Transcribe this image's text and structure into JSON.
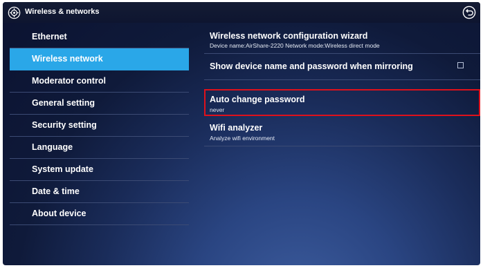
{
  "window": {
    "title": "Wireless & networks"
  },
  "sidebar": {
    "items": [
      {
        "label": "Ethernet"
      },
      {
        "label": "Wireless network"
      },
      {
        "label": "Moderator control"
      },
      {
        "label": "General setting"
      },
      {
        "label": "Security setting"
      },
      {
        "label": "Language"
      },
      {
        "label": "System update"
      },
      {
        "label": "Date & time"
      },
      {
        "label": "About device"
      }
    ],
    "active_index": 1
  },
  "settings": {
    "wizard": {
      "title": "Wireless network configuration wizard",
      "subtitle": "Device name:AirShare-2220   Network mode:Wireless direct mode"
    },
    "show_password": {
      "title": "Show device name and password when mirroring",
      "checked": false
    },
    "auto_change": {
      "title": "Auto change password",
      "value": "never"
    },
    "wifi_analyzer": {
      "title": "Wifi analyzer",
      "subtitle": "Analyze wifi environment"
    }
  },
  "colors": {
    "accent": "#2aa7e8",
    "highlight_border": "#e0111b"
  },
  "icons": {
    "settings": "gear-icon",
    "back": "back-icon"
  }
}
